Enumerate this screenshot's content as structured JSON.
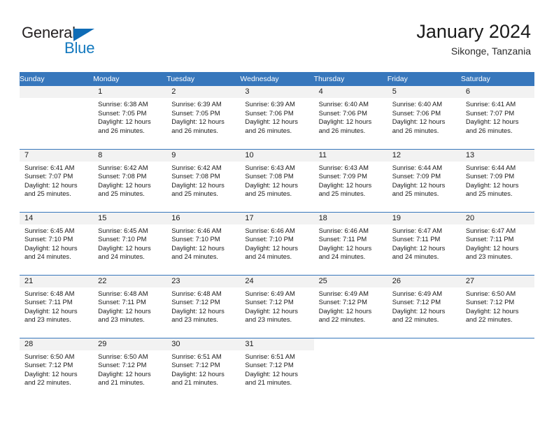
{
  "logo": {
    "word_one": "General",
    "word_two": "Blue",
    "triangle_color": "#0f6cb6",
    "blue_text_color": "#1278be"
  },
  "header": {
    "title": "January 2024",
    "subtitle": "Sikonge, Tanzania"
  },
  "theme": {
    "header_band": "#3777bc",
    "daynum_band": "#f2f2f2",
    "text": "#1a1a1a"
  },
  "weekday_headers": [
    "Sunday",
    "Monday",
    "Tuesday",
    "Wednesday",
    "Thursday",
    "Friday",
    "Saturday"
  ],
  "weeks": [
    [
      {
        "day": "",
        "sunrise": "",
        "sunset": "",
        "daylight_line1": "",
        "daylight_line2": ""
      },
      {
        "day": "1",
        "sunrise": "Sunrise: 6:38 AM",
        "sunset": "Sunset: 7:05 PM",
        "daylight_line1": "Daylight: 12 hours",
        "daylight_line2": "and 26 minutes."
      },
      {
        "day": "2",
        "sunrise": "Sunrise: 6:39 AM",
        "sunset": "Sunset: 7:05 PM",
        "daylight_line1": "Daylight: 12 hours",
        "daylight_line2": "and 26 minutes."
      },
      {
        "day": "3",
        "sunrise": "Sunrise: 6:39 AM",
        "sunset": "Sunset: 7:06 PM",
        "daylight_line1": "Daylight: 12 hours",
        "daylight_line2": "and 26 minutes."
      },
      {
        "day": "4",
        "sunrise": "Sunrise: 6:40 AM",
        "sunset": "Sunset: 7:06 PM",
        "daylight_line1": "Daylight: 12 hours",
        "daylight_line2": "and 26 minutes."
      },
      {
        "day": "5",
        "sunrise": "Sunrise: 6:40 AM",
        "sunset": "Sunset: 7:06 PM",
        "daylight_line1": "Daylight: 12 hours",
        "daylight_line2": "and 26 minutes."
      },
      {
        "day": "6",
        "sunrise": "Sunrise: 6:41 AM",
        "sunset": "Sunset: 7:07 PM",
        "daylight_line1": "Daylight: 12 hours",
        "daylight_line2": "and 26 minutes."
      }
    ],
    [
      {
        "day": "7",
        "sunrise": "Sunrise: 6:41 AM",
        "sunset": "Sunset: 7:07 PM",
        "daylight_line1": "Daylight: 12 hours",
        "daylight_line2": "and 25 minutes."
      },
      {
        "day": "8",
        "sunrise": "Sunrise: 6:42 AM",
        "sunset": "Sunset: 7:08 PM",
        "daylight_line1": "Daylight: 12 hours",
        "daylight_line2": "and 25 minutes."
      },
      {
        "day": "9",
        "sunrise": "Sunrise: 6:42 AM",
        "sunset": "Sunset: 7:08 PM",
        "daylight_line1": "Daylight: 12 hours",
        "daylight_line2": "and 25 minutes."
      },
      {
        "day": "10",
        "sunrise": "Sunrise: 6:43 AM",
        "sunset": "Sunset: 7:08 PM",
        "daylight_line1": "Daylight: 12 hours",
        "daylight_line2": "and 25 minutes."
      },
      {
        "day": "11",
        "sunrise": "Sunrise: 6:43 AM",
        "sunset": "Sunset: 7:09 PM",
        "daylight_line1": "Daylight: 12 hours",
        "daylight_line2": "and 25 minutes."
      },
      {
        "day": "12",
        "sunrise": "Sunrise: 6:44 AM",
        "sunset": "Sunset: 7:09 PM",
        "daylight_line1": "Daylight: 12 hours",
        "daylight_line2": "and 25 minutes."
      },
      {
        "day": "13",
        "sunrise": "Sunrise: 6:44 AM",
        "sunset": "Sunset: 7:09 PM",
        "daylight_line1": "Daylight: 12 hours",
        "daylight_line2": "and 25 minutes."
      }
    ],
    [
      {
        "day": "14",
        "sunrise": "Sunrise: 6:45 AM",
        "sunset": "Sunset: 7:10 PM",
        "daylight_line1": "Daylight: 12 hours",
        "daylight_line2": "and 24 minutes."
      },
      {
        "day": "15",
        "sunrise": "Sunrise: 6:45 AM",
        "sunset": "Sunset: 7:10 PM",
        "daylight_line1": "Daylight: 12 hours",
        "daylight_line2": "and 24 minutes."
      },
      {
        "day": "16",
        "sunrise": "Sunrise: 6:46 AM",
        "sunset": "Sunset: 7:10 PM",
        "daylight_line1": "Daylight: 12 hours",
        "daylight_line2": "and 24 minutes."
      },
      {
        "day": "17",
        "sunrise": "Sunrise: 6:46 AM",
        "sunset": "Sunset: 7:10 PM",
        "daylight_line1": "Daylight: 12 hours",
        "daylight_line2": "and 24 minutes."
      },
      {
        "day": "18",
        "sunrise": "Sunrise: 6:46 AM",
        "sunset": "Sunset: 7:11 PM",
        "daylight_line1": "Daylight: 12 hours",
        "daylight_line2": "and 24 minutes."
      },
      {
        "day": "19",
        "sunrise": "Sunrise: 6:47 AM",
        "sunset": "Sunset: 7:11 PM",
        "daylight_line1": "Daylight: 12 hours",
        "daylight_line2": "and 24 minutes."
      },
      {
        "day": "20",
        "sunrise": "Sunrise: 6:47 AM",
        "sunset": "Sunset: 7:11 PM",
        "daylight_line1": "Daylight: 12 hours",
        "daylight_line2": "and 23 minutes."
      }
    ],
    [
      {
        "day": "21",
        "sunrise": "Sunrise: 6:48 AM",
        "sunset": "Sunset: 7:11 PM",
        "daylight_line1": "Daylight: 12 hours",
        "daylight_line2": "and 23 minutes."
      },
      {
        "day": "22",
        "sunrise": "Sunrise: 6:48 AM",
        "sunset": "Sunset: 7:11 PM",
        "daylight_line1": "Daylight: 12 hours",
        "daylight_line2": "and 23 minutes."
      },
      {
        "day": "23",
        "sunrise": "Sunrise: 6:48 AM",
        "sunset": "Sunset: 7:12 PM",
        "daylight_line1": "Daylight: 12 hours",
        "daylight_line2": "and 23 minutes."
      },
      {
        "day": "24",
        "sunrise": "Sunrise: 6:49 AM",
        "sunset": "Sunset: 7:12 PM",
        "daylight_line1": "Daylight: 12 hours",
        "daylight_line2": "and 23 minutes."
      },
      {
        "day": "25",
        "sunrise": "Sunrise: 6:49 AM",
        "sunset": "Sunset: 7:12 PM",
        "daylight_line1": "Daylight: 12 hours",
        "daylight_line2": "and 22 minutes."
      },
      {
        "day": "26",
        "sunrise": "Sunrise: 6:49 AM",
        "sunset": "Sunset: 7:12 PM",
        "daylight_line1": "Daylight: 12 hours",
        "daylight_line2": "and 22 minutes."
      },
      {
        "day": "27",
        "sunrise": "Sunrise: 6:50 AM",
        "sunset": "Sunset: 7:12 PM",
        "daylight_line1": "Daylight: 12 hours",
        "daylight_line2": "and 22 minutes."
      }
    ],
    [
      {
        "day": "28",
        "sunrise": "Sunrise: 6:50 AM",
        "sunset": "Sunset: 7:12 PM",
        "daylight_line1": "Daylight: 12 hours",
        "daylight_line2": "and 22 minutes."
      },
      {
        "day": "29",
        "sunrise": "Sunrise: 6:50 AM",
        "sunset": "Sunset: 7:12 PM",
        "daylight_line1": "Daylight: 12 hours",
        "daylight_line2": "and 21 minutes."
      },
      {
        "day": "30",
        "sunrise": "Sunrise: 6:51 AM",
        "sunset": "Sunset: 7:12 PM",
        "daylight_line1": "Daylight: 12 hours",
        "daylight_line2": "and 21 minutes."
      },
      {
        "day": "31",
        "sunrise": "Sunrise: 6:51 AM",
        "sunset": "Sunset: 7:12 PM",
        "daylight_line1": "Daylight: 12 hours",
        "daylight_line2": "and 21 minutes."
      },
      {
        "day": "",
        "sunrise": "",
        "sunset": "",
        "daylight_line1": "",
        "daylight_line2": ""
      },
      {
        "day": "",
        "sunrise": "",
        "sunset": "",
        "daylight_line1": "",
        "daylight_line2": ""
      },
      {
        "day": "",
        "sunrise": "",
        "sunset": "",
        "daylight_line1": "",
        "daylight_line2": ""
      }
    ]
  ]
}
